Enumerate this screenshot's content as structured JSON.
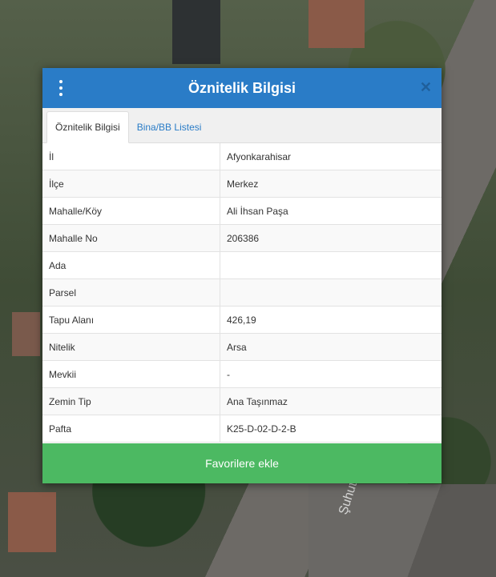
{
  "map": {
    "road_label": "Şuhut Y"
  },
  "dialog": {
    "title": "Öznitelik Bilgisi",
    "close_symbol": "✕",
    "tabs": [
      {
        "label": "Öznitelik Bilgisi",
        "active": true
      },
      {
        "label": "Bina/BB Listesi",
        "active": false
      }
    ],
    "rows": [
      {
        "key": "İl",
        "value": "Afyonkarahisar"
      },
      {
        "key": "İlçe",
        "value": "Merkez"
      },
      {
        "key": "Mahalle/Köy",
        "value": "Ali İhsan Paşa"
      },
      {
        "key": "Mahalle No",
        "value": "206386"
      },
      {
        "key": "Ada",
        "value": ""
      },
      {
        "key": "Parsel",
        "value": ""
      },
      {
        "key": "Tapu Alanı",
        "value": "426,19"
      },
      {
        "key": "Nitelik",
        "value": "Arsa"
      },
      {
        "key": "Mevkii",
        "value": "-"
      },
      {
        "key": "Zemin Tip",
        "value": "Ana Taşınmaz"
      },
      {
        "key": "Pafta",
        "value": "K25-D-02-D-2-B"
      }
    ],
    "fav_button_label": "Favorilere ekle"
  },
  "colors": {
    "header": "#2a7cc7",
    "button": "#4cb962"
  }
}
